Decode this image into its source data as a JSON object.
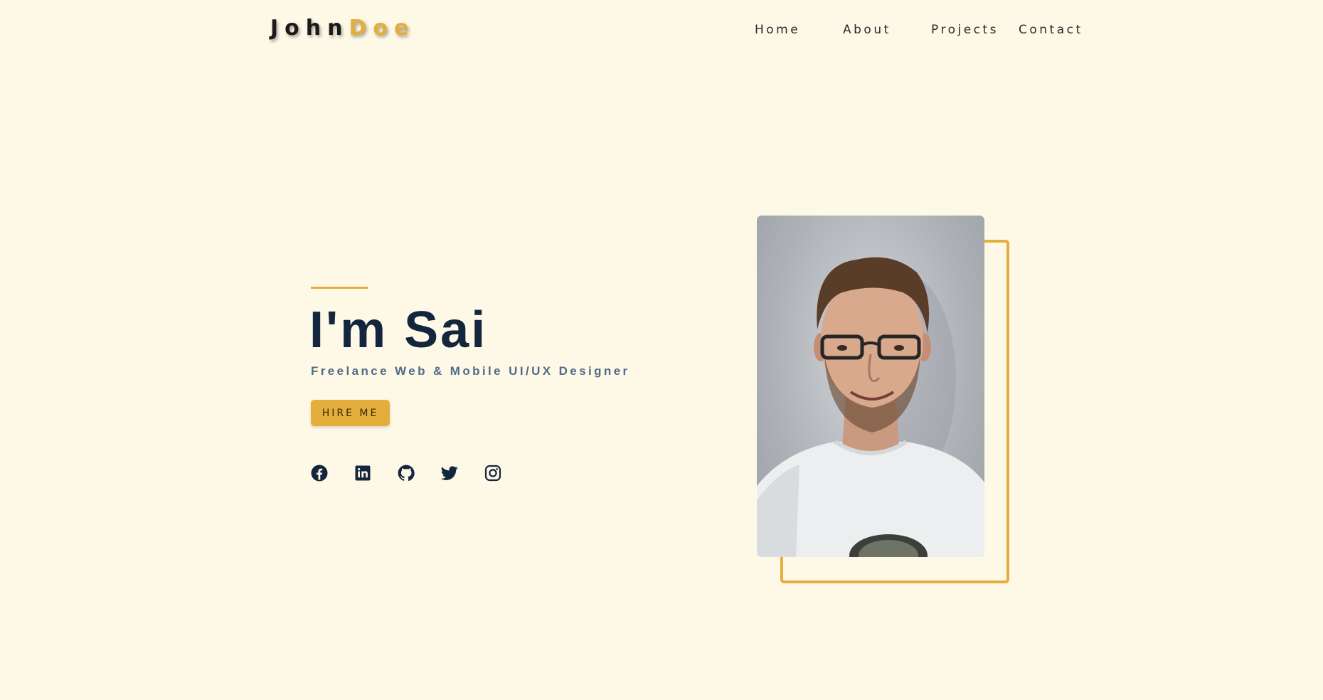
{
  "header": {
    "logo_first": "John",
    "logo_accent": "Doe",
    "nav": [
      "Home",
      "About",
      "Projects",
      "Contact"
    ]
  },
  "hero": {
    "title": "I'm Sai",
    "subtitle": "Freelance Web & Mobile UI/UX Designer",
    "cta_label": "HIRE ME",
    "socials": [
      "facebook-icon",
      "linkedin-icon",
      "github-icon",
      "twitter-icon",
      "instagram-icon"
    ]
  },
  "colors": {
    "background": "#fef9e6",
    "accent": "#e4ae3d",
    "heading": "#14263d",
    "subtitle": "#506b87"
  }
}
